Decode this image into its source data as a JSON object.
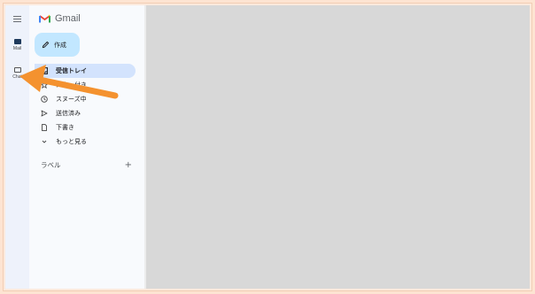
{
  "app": {
    "logo_text": "Gmail",
    "brand_colors": [
      "#EA4335",
      "#4285F4",
      "#34A853",
      "#FBBC05"
    ]
  },
  "rail": {
    "menu_icon": "hamburger-icon",
    "items": [
      {
        "label": "Mail",
        "icon": "mail-icon",
        "active": true
      },
      {
        "label": "Chat",
        "icon": "chat-icon",
        "active": false
      }
    ]
  },
  "compose": {
    "label": "作成",
    "icon": "pencil-icon",
    "color": "#c2e7ff"
  },
  "nav": {
    "items": [
      {
        "label": "受信トレイ",
        "icon": "inbox-icon",
        "active": true
      },
      {
        "label": "スター付き",
        "icon": "star-icon",
        "active": false
      },
      {
        "label": "スヌーズ中",
        "icon": "clock-icon",
        "active": false
      },
      {
        "label": "送信済み",
        "icon": "send-icon",
        "active": false
      },
      {
        "label": "下書き",
        "icon": "draft-icon",
        "active": false
      },
      {
        "label": "もっと見る",
        "icon": "chevron-down-icon",
        "active": false
      }
    ]
  },
  "labels_section": {
    "title": "ラベル",
    "add_icon": "plus-icon"
  },
  "overlay": {
    "pointer": "orange-arrow",
    "color": "#f4922f"
  }
}
